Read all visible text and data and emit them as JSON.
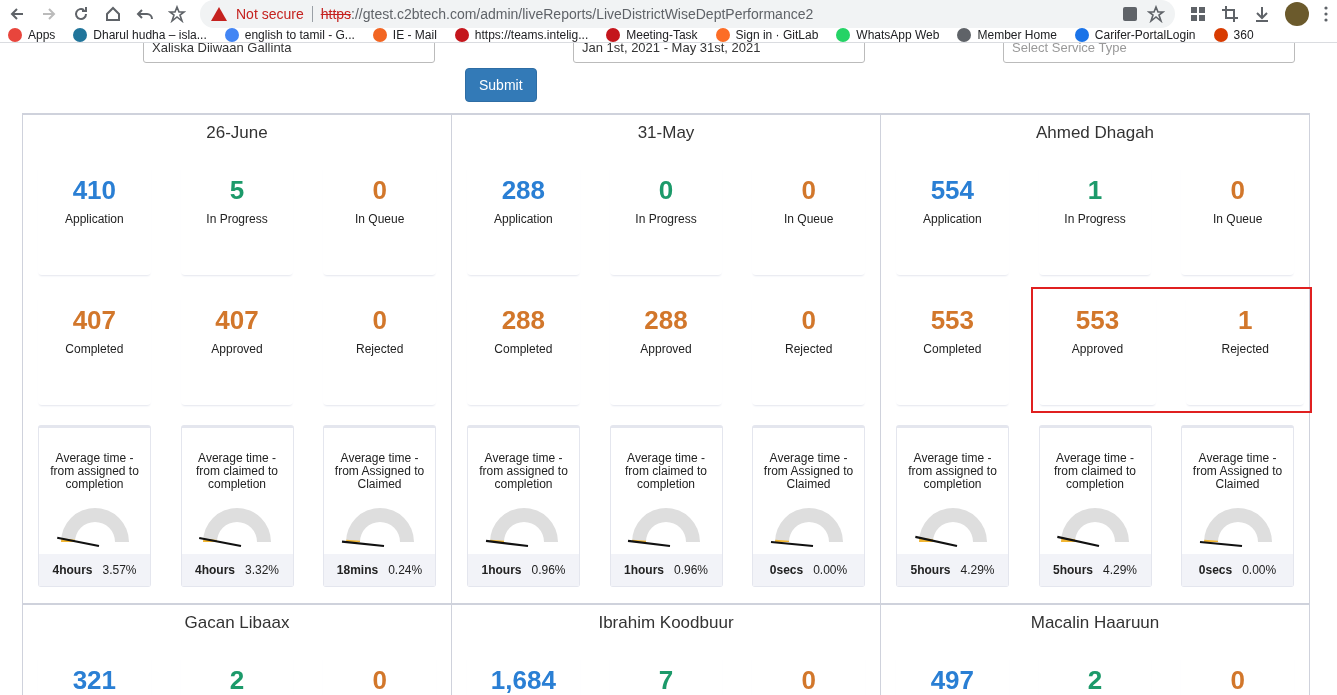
{
  "browser": {
    "security": "Not secure",
    "url_scheme": "https",
    "url_rest": "://gtest.c2btech.com/admin/liveReports/LiveDistrictWiseDeptPerformance2",
    "bookmarks": [
      "Apps",
      "Dharul hudha – isla...",
      "english to tamil - G...",
      "IE - Mail",
      "https://teams.intelig...",
      "Meeting-Task",
      "Sign in · GitLab",
      "WhatsApp Web",
      "Member Home",
      "Carifer-PortalLogin",
      "360"
    ]
  },
  "filters": {
    "district": "Xaliska Diiwaan Gallinta",
    "date_range": "Jan 1st, 2021 - May 31st, 2021",
    "service_placeholder": "Select Service Type",
    "submit": "Submit"
  },
  "panels": [
    {
      "title": "26-June",
      "rows": [
        [
          {
            "value": "410",
            "label": "Application",
            "color": "#2a7fd4",
            "annotated": false
          },
          {
            "value": "5",
            "label": "In Progress",
            "color": "#1c9a6a",
            "annotated": false
          },
          {
            "value": "0",
            "label": "In Queue",
            "color": "#d2772b",
            "annotated": false
          }
        ],
        [
          {
            "value": "407",
            "label": "Completed",
            "color": "#d2772b",
            "annotated": false
          },
          {
            "value": "407",
            "label": "Approved",
            "color": "#d2772b",
            "annotated": false
          },
          {
            "value": "0",
            "label": "Rejected",
            "color": "#d2772b",
            "annotated": false
          }
        ]
      ],
      "gauges": [
        {
          "caption": "Average time - from assigned to completion",
          "time": "4hours",
          "percent": "3.57%",
          "level": 0.0357
        },
        {
          "caption": "Average time - from claimed to completion",
          "time": "4hours",
          "percent": "3.32%",
          "level": 0.0332
        },
        {
          "caption": "Average time - from Assigned to Claimed",
          "time": "18mins",
          "percent": "0.24%",
          "level": 0.0024
        }
      ]
    },
    {
      "title": "31-May",
      "rows": [
        [
          {
            "value": "288",
            "label": "Application",
            "color": "#2a7fd4",
            "annotated": false
          },
          {
            "value": "0",
            "label": "In Progress",
            "color": "#1c9a6a",
            "annotated": false
          },
          {
            "value": "0",
            "label": "In Queue",
            "color": "#d2772b",
            "annotated": false
          }
        ],
        [
          {
            "value": "288",
            "label": "Completed",
            "color": "#d2772b",
            "annotated": false
          },
          {
            "value": "288",
            "label": "Approved",
            "color": "#d2772b",
            "annotated": false
          },
          {
            "value": "0",
            "label": "Rejected",
            "color": "#d2772b",
            "annotated": false
          }
        ]
      ],
      "gauges": [
        {
          "caption": "Average time - from assigned to completion",
          "time": "1hours",
          "percent": "0.96%",
          "level": 0.0096
        },
        {
          "caption": "Average time - from claimed to completion",
          "time": "1hours",
          "percent": "0.96%",
          "level": 0.0096
        },
        {
          "caption": "Average time - from Assigned to Claimed",
          "time": "0secs",
          "percent": "0.00%",
          "level": 0
        }
      ]
    },
    {
      "title": "Ahmed Dhagah",
      "rows": [
        [
          {
            "value": "554",
            "label": "Application",
            "color": "#2a7fd4",
            "annotated": false
          },
          {
            "value": "1",
            "label": "In Progress",
            "color": "#1c9a6a",
            "annotated": false
          },
          {
            "value": "0",
            "label": "In Queue",
            "color": "#d2772b",
            "annotated": false
          }
        ],
        [
          {
            "value": "553",
            "label": "Completed",
            "color": "#d2772b",
            "annotated": false
          },
          {
            "value": "553",
            "label": "Approved",
            "color": "#d2772b",
            "annotated": true
          },
          {
            "value": "1",
            "label": "Rejected",
            "color": "#d2772b",
            "annotated": true
          }
        ]
      ],
      "gauges": [
        {
          "caption": "Average time - from assigned to completion",
          "time": "5hours",
          "percent": "4.29%",
          "level": 0.0429
        },
        {
          "caption": "Average time - from claimed to completion",
          "time": "5hours",
          "percent": "4.29%",
          "level": 0.0429
        },
        {
          "caption": "Average time - from Assigned to Claimed",
          "time": "0secs",
          "percent": "0.00%",
          "level": 0
        }
      ]
    },
    {
      "title": "Gacan Libaax",
      "rows": [
        [
          {
            "value": "321",
            "color": "#2a7fd4",
            "annotated": false
          },
          {
            "value": "2",
            "color": "#1c9a6a",
            "annotated": false
          },
          {
            "value": "0",
            "color": "#d2772b",
            "annotated": false
          }
        ]
      ]
    },
    {
      "title": "Ibrahim Koodbuur",
      "rows": [
        [
          {
            "value": "1,684",
            "color": "#2a7fd4",
            "annotated": false
          },
          {
            "value": "7",
            "color": "#1c9a6a",
            "annotated": false
          },
          {
            "value": "0",
            "color": "#d2772b",
            "annotated": false
          }
        ]
      ]
    },
    {
      "title": "Macalin Haaruun",
      "rows": [
        [
          {
            "value": "497",
            "color": "#2a7fd4",
            "annotated": false
          },
          {
            "value": "2",
            "color": "#1c9a6a",
            "annotated": false
          },
          {
            "value": "0",
            "color": "#d2772b",
            "annotated": false
          }
        ]
      ]
    }
  ]
}
